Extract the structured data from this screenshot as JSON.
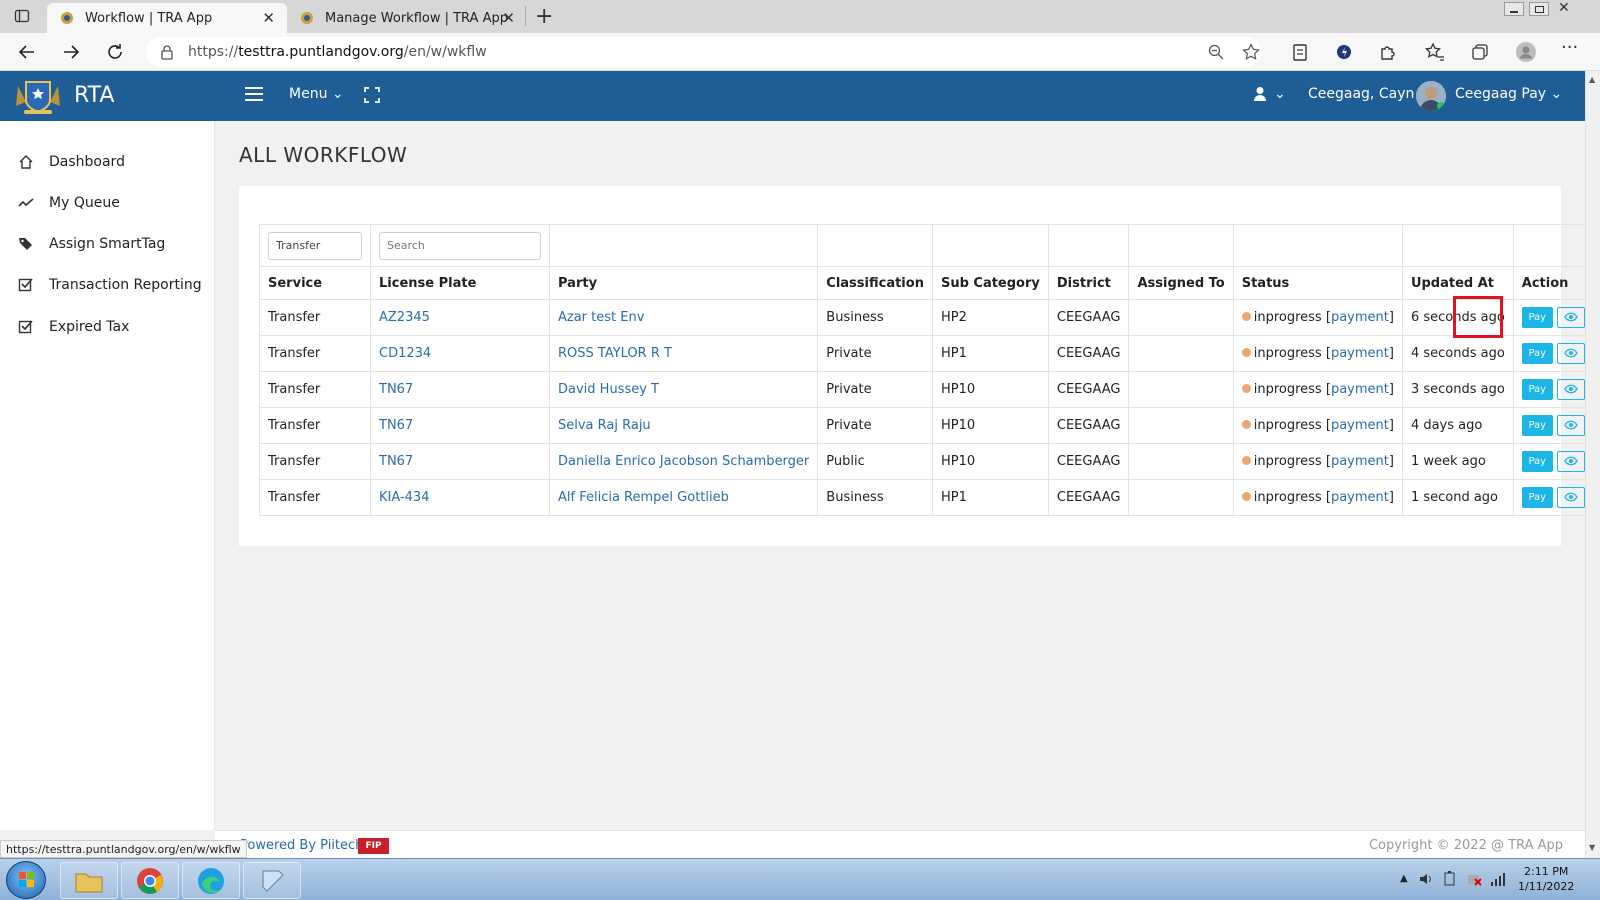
{
  "browser": {
    "tabs": [
      {
        "title": "Workflow | TRA App",
        "active": true
      },
      {
        "title": "Manage Workflow | TRA App",
        "active": false
      }
    ],
    "url_prefix": "https://",
    "url_domain": "testtra.puntlandgov.org",
    "url_path": "/en/w/wkflw",
    "status_url": "https://testtra.puntlandgov.org/en/w/wkflw"
  },
  "header": {
    "brand": "RTA",
    "menu_label": "Menu",
    "user_location": "Ceegaag, Cayn",
    "user_name": "Ceegaag Pay",
    "color": "#1f5d97"
  },
  "sidebar": {
    "items": [
      {
        "label": "Dashboard",
        "icon": "home-icon"
      },
      {
        "label": "My Queue",
        "icon": "trend-line-icon"
      },
      {
        "label": "Assign SmartTag",
        "icon": "tags-icon"
      },
      {
        "label": "Transaction Reporting",
        "icon": "check-square-icon"
      },
      {
        "label": "Expired Tax",
        "icon": "check-square-icon"
      }
    ]
  },
  "page": {
    "title": "ALL WORKFLOW"
  },
  "filters": {
    "service_value": "Transfer",
    "search_placeholder": "Search"
  },
  "table": {
    "columns": [
      "Service",
      "License Plate",
      "Party",
      "Classification",
      "Sub Category",
      "District",
      "Assigned To",
      "Status",
      "Updated At",
      "Action"
    ],
    "rows": [
      {
        "service": "Transfer",
        "plate": "AZ2345",
        "party": "Azar test Env",
        "classification": "Business",
        "sub_category": "HP2",
        "district": "CEEGAAG",
        "assigned_to": "",
        "status": "inprogress",
        "status_link": "payment",
        "updated": "6 seconds ago"
      },
      {
        "service": "Transfer",
        "plate": "CD1234",
        "party": "ROSS TAYLOR R T",
        "classification": "Private",
        "sub_category": "HP1",
        "district": "CEEGAAG",
        "assigned_to": "",
        "status": "inprogress",
        "status_link": "payment",
        "updated": "4 seconds ago"
      },
      {
        "service": "Transfer",
        "plate": "TN67",
        "party": "David Hussey T",
        "classification": "Private",
        "sub_category": "HP10",
        "district": "CEEGAAG",
        "assigned_to": "",
        "status": "inprogress",
        "status_link": "payment",
        "updated": "3 seconds ago"
      },
      {
        "service": "Transfer",
        "plate": "TN67",
        "party": "Selva Raj Raju",
        "classification": "Private",
        "sub_category": "HP10",
        "district": "CEEGAAG",
        "assigned_to": "",
        "status": "inprogress",
        "status_link": "payment",
        "updated": "4 days ago"
      },
      {
        "service": "Transfer",
        "plate": "TN67",
        "party": "Daniella Enrico Jacobson Schamberger",
        "classification": "Public",
        "sub_category": "HP10",
        "district": "CEEGAAG",
        "assigned_to": "",
        "status": "inprogress",
        "status_link": "payment",
        "updated": "1 week ago"
      },
      {
        "service": "Transfer",
        "plate": "KIA-434",
        "party": "Alf Felicia Rempel Gottlieb",
        "classification": "Business",
        "sub_category": "HP1",
        "district": "CEEGAAG",
        "assigned_to": "",
        "status": "inprogress",
        "status_link": "payment",
        "updated": "1 second ago"
      }
    ],
    "pay_label": "Pay"
  },
  "footer": {
    "powered": "Powered By Piitech",
    "logo_text": "FIP",
    "copyright": "Copyright © 2022 @ TRA App"
  },
  "taskbar": {
    "time": "2:11 PM",
    "date": "1/11/2022"
  }
}
